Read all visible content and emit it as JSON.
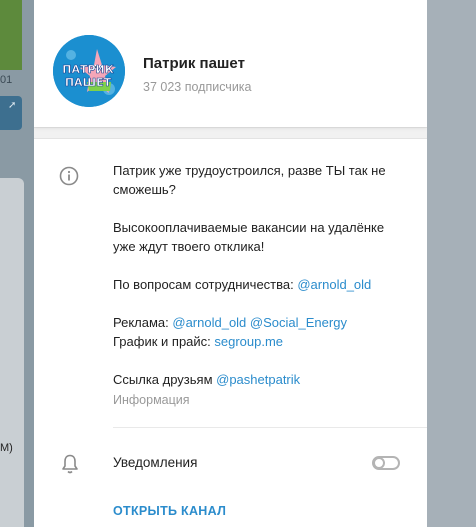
{
  "background": {
    "fragment_top": "01",
    "fragment_bottom": "M)"
  },
  "channel": {
    "name": "Патрик пашет",
    "subscribers": "37 023 подписчика",
    "avatar_text_line1": "ПАТРИК",
    "avatar_text_line2": "ПАШЕТ"
  },
  "info": {
    "line1": "Патрик уже трудоустроился, разве ТЫ так не сможешь?",
    "line2": "Высокооплачиваемые вакансии на удалёнке уже ждут твоего отклика!",
    "coop_text": "По вопросам сотрудничества: ",
    "coop_link": "@arnold_old",
    "ads_text": "Реклама: ",
    "ads_link1": "@arnold_old",
    "ads_link2": "@Social_Energy",
    "price_text": "График и прайс: ",
    "price_link": "segroup.me",
    "friends_text": "Ссылка друзьям ",
    "friends_link": "@pashetpatrik",
    "caption": "Информация"
  },
  "notifications": {
    "label": "Уведомления",
    "enabled": false
  },
  "open_button": "ОТКРЫТЬ КАНАЛ",
  "colors": {
    "accent": "#2b8ccc",
    "avatar_bg": "#1b8fd0"
  }
}
